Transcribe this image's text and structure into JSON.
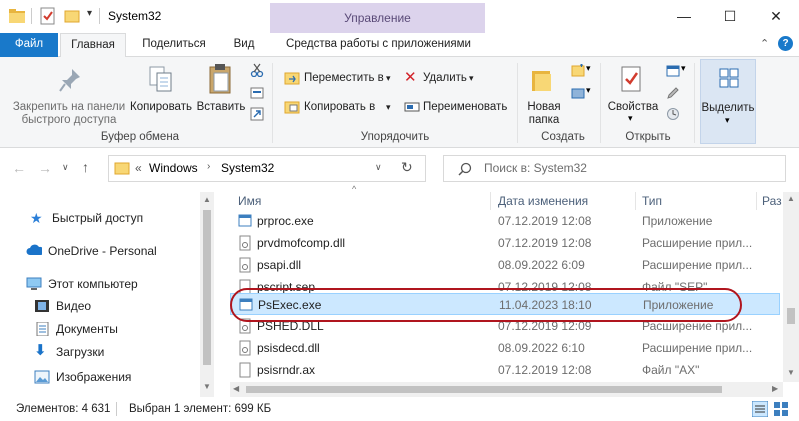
{
  "window": {
    "title": "System32",
    "context_tab": "Управление",
    "controls": {
      "minimize": "—",
      "maximize": "☐",
      "close": "✕"
    }
  },
  "ribbon_tabs": {
    "file": "Файл",
    "home": "Главная",
    "share": "Поделиться",
    "view": "Вид",
    "app_tools": "Средства работы с приложениями"
  },
  "clipboard": {
    "pin": "Закрепить на панели быстрого доступа",
    "pin_l1": "Закрепить на панели",
    "pin_l2": "быстрого доступа",
    "copy": "Копировать",
    "paste": "Вставить",
    "group": "Буфер обмена"
  },
  "organize": {
    "move": "Переместить в",
    "copy_to": "Копировать в",
    "delete": "Удалить",
    "rename": "Переименовать",
    "group": "Упорядочить"
  },
  "new": {
    "folder_l1": "Новая",
    "folder_l2": "папка",
    "group": "Создать"
  },
  "open": {
    "properties": "Свойства",
    "group": "Открыть"
  },
  "select": {
    "label": "Выделить"
  },
  "address": {
    "overflow": "«",
    "crumbs": [
      "Windows",
      "System32"
    ],
    "search_placeholder": "Поиск в: System32"
  },
  "nav": {
    "items": [
      {
        "label": "Быстрый доступ"
      },
      {
        "label": "OneDrive - Personal"
      },
      {
        "label": "Этот компьютер"
      },
      {
        "label": "Видео"
      },
      {
        "label": "Документы"
      },
      {
        "label": "Загрузки"
      },
      {
        "label": "Изображения"
      }
    ]
  },
  "columns": {
    "name": "Имя",
    "date": "Дата изменения",
    "type": "Тип",
    "size": "Раз"
  },
  "files": [
    {
      "name": "prproc.exe",
      "date": "07.12.2019 12:08",
      "type": "Приложение"
    },
    {
      "name": "prvdmofcomp.dll",
      "date": "07.12.2019 12:08",
      "type": "Расширение прил..."
    },
    {
      "name": "psapi.dll",
      "date": "08.09.2022 6:09",
      "type": "Расширение прил..."
    },
    {
      "name": "pscript.sep",
      "date": "07.12.2019 12:08",
      "type": "Файл \"SEP\""
    },
    {
      "name": "PsExec.exe",
      "date": "11.04.2023 18:10",
      "type": "Приложение"
    },
    {
      "name": "PSHED.DLL",
      "date": "07.12.2019 12:09",
      "type": "Расширение прил..."
    },
    {
      "name": "psisdecd.dll",
      "date": "08.09.2022 6:10",
      "type": "Расширение прил..."
    },
    {
      "name": "psisrndr.ax",
      "date": "07.12.2019 12:08",
      "type": "Файл \"AX\""
    }
  ],
  "status": {
    "count": "Элементов: 4 631",
    "selected": "Выбран 1 элемент: 699 КБ"
  },
  "colors": {
    "file_tab": "#1979ca",
    "context_tab_bg": "#dcd3ec",
    "selection_bg": "#cce8ff",
    "highlight_ring": "#b0151e"
  }
}
